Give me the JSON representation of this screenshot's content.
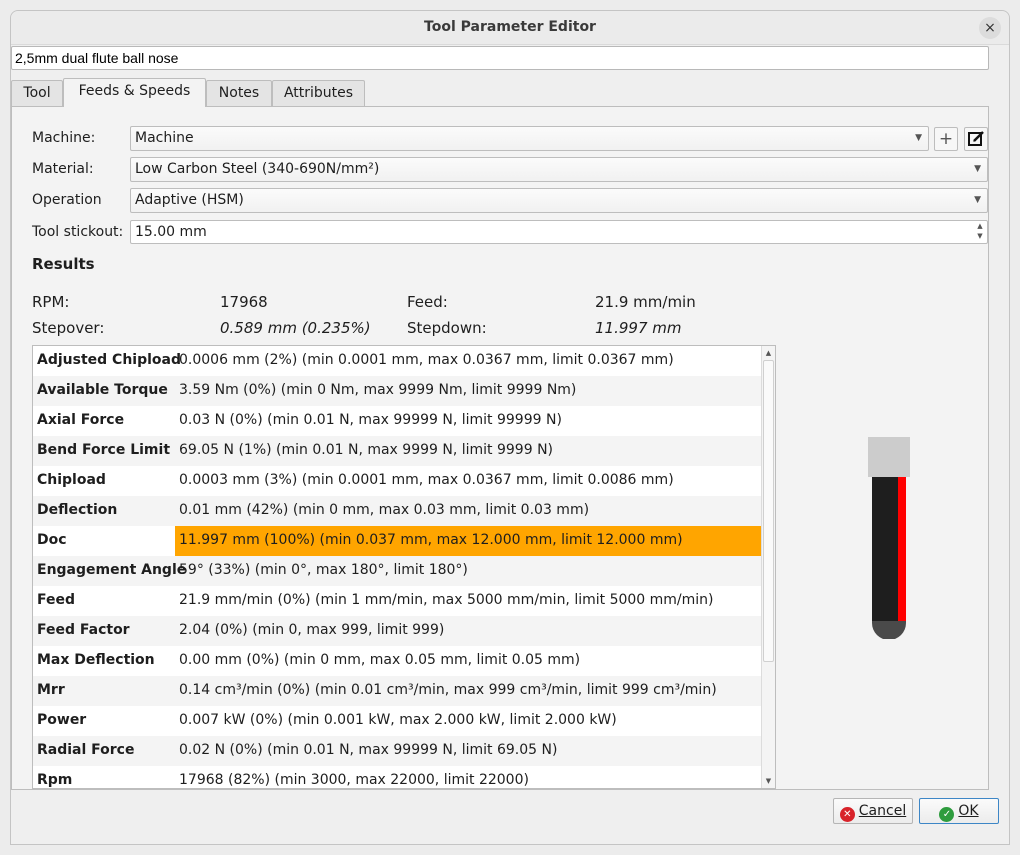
{
  "window": {
    "title": "Tool Parameter Editor",
    "close": "×"
  },
  "tool_name": "2,5mm dual flute ball nose",
  "tabs": [
    {
      "label": "Tool"
    },
    {
      "label": "Feeds & Speeds"
    },
    {
      "label": "Notes"
    },
    {
      "label": "Attributes"
    }
  ],
  "form": {
    "machine_label": "Machine:",
    "machine_value": "Machine",
    "add_symbol": "+",
    "material_label": "Material:",
    "material_value": "Low Carbon Steel (340-690N/mm²)",
    "operation_label": "Operation",
    "operation_value": "Adaptive (HSM)",
    "stickout_label": "Tool stickout:",
    "stickout_value": "15.00 mm"
  },
  "results": {
    "heading": "Results",
    "rpm_label": "RPM:",
    "rpm_value": "17968",
    "feed_label": "Feed:",
    "feed_value": "21.9 mm/min",
    "stepover_label": "Stepover:",
    "stepover_value": "0.589 mm (0.235%)",
    "stepdown_label": "Stepdown:",
    "stepdown_value": "11.997 mm"
  },
  "table": [
    {
      "key": "Adjusted Chipload",
      "value": "0.0006 mm (2%) (min 0.0001 mm, max 0.0367 mm, limit 0.0367 mm)"
    },
    {
      "key": "Available Torque",
      "value": "3.59 Nm (0%) (min 0 Nm, max 9999 Nm, limit 9999 Nm)"
    },
    {
      "key": "Axial Force",
      "value": "0.03 N (0%) (min 0.01 N, max 99999 N, limit 99999 N)"
    },
    {
      "key": "Bend Force Limit",
      "value": "69.05 N (1%) (min 0.01 N, max 9999 N, limit 9999 N)"
    },
    {
      "key": "Chipload",
      "value": "0.0003 mm (3%) (min 0.0001 mm, max 0.0367 mm, limit 0.0086 mm)"
    },
    {
      "key": "Deflection",
      "value": "0.01 mm (42%) (min 0 mm, max 0.03 mm, limit 0.03 mm)"
    },
    {
      "key": "Doc",
      "value": "11.997 mm (100%) (min 0.037 mm, max 12.000 mm, limit 12.000 mm)"
    },
    {
      "key": "Engagement Angle",
      "value": "59° (33%) (min 0°, max 180°, limit 180°)"
    },
    {
      "key": "Feed",
      "value": "21.9 mm/min (0%) (min 1 mm/min, max 5000 mm/min, limit 5000 mm/min)"
    },
    {
      "key": "Feed Factor",
      "value": "2.04 (0%) (min 0, max 999, limit 999)"
    },
    {
      "key": "Max Deflection",
      "value": "0.00 mm (0%) (min 0 mm, max 0.05 mm, limit 0.05 mm)"
    },
    {
      "key": "Mrr",
      "value": "0.14 cm³/min (0%) (min 0.01 cm³/min, max 999 cm³/min, limit 999 cm³/min)"
    },
    {
      "key": "Power",
      "value": "0.007 kW (0%) (min 0.001 kW, max 2.000 kW, limit 2.000 kW)"
    },
    {
      "key": "Radial Force",
      "value": "0.02 N (0%) (min 0.01 N, max 99999 N, limit 69.05 N)"
    },
    {
      "key": "Rpm",
      "value": "17968 (82%) (min 3000, max 22000, limit 22000)"
    }
  ],
  "highlight_color": "#ffa500",
  "buttons": {
    "cancel_label": "Cancel",
    "cancel_icon": "cancel-icon",
    "ok_label": "OK",
    "ok_icon": "check-icon"
  },
  "preview": {
    "shank_color": "#cccccc",
    "flute_color": "#1e1e1e",
    "engagement_color": "#ff0000",
    "tip_color": "#4a4a4a"
  }
}
